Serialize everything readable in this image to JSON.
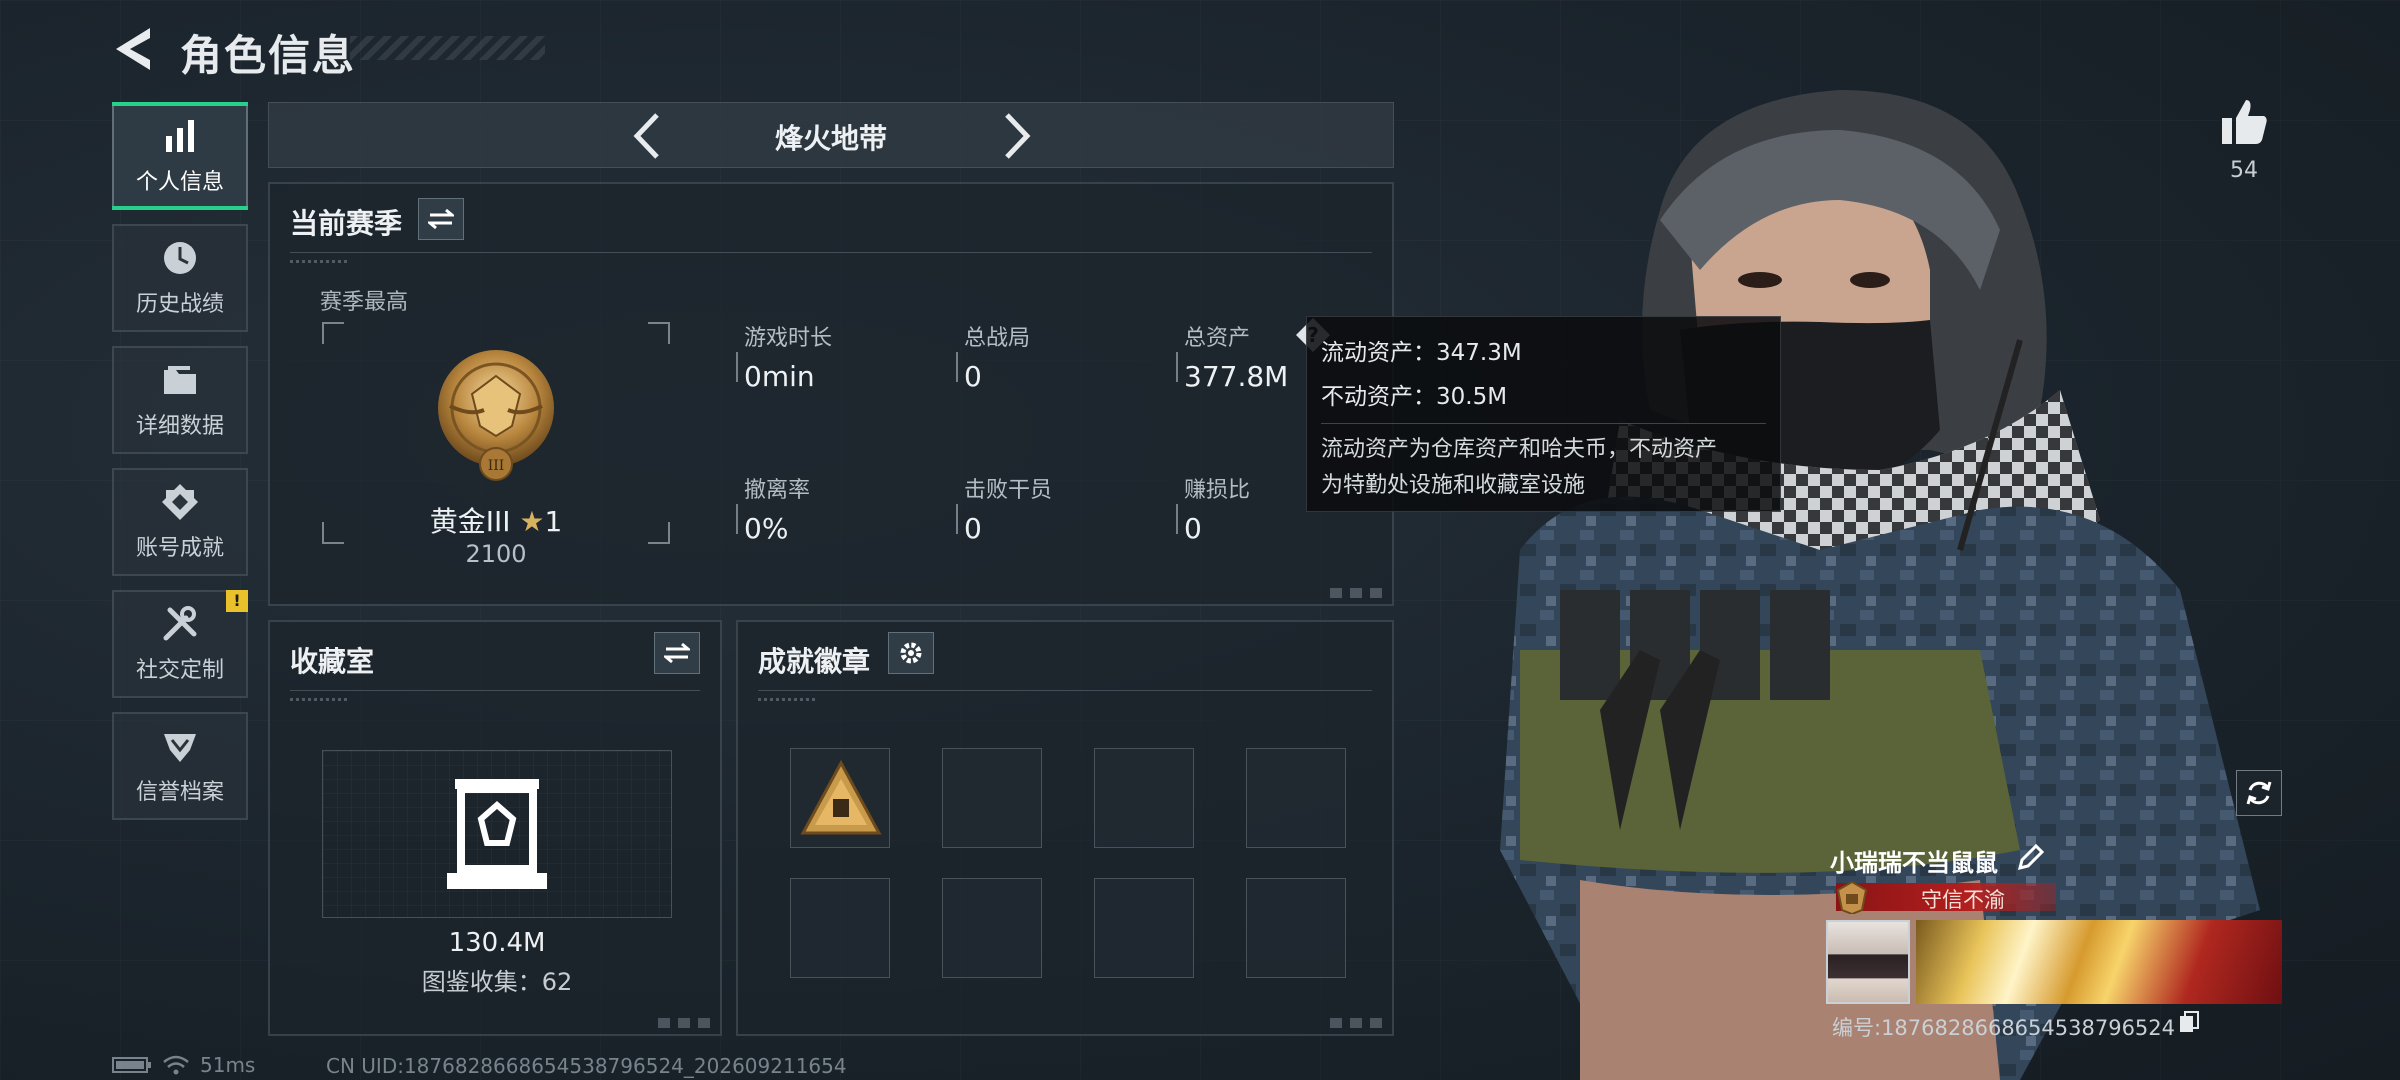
{
  "header": {
    "title": "角色信息"
  },
  "nav": {
    "items": [
      {
        "label": "个人信息",
        "icon": "bar-chart-icon",
        "active": true
      },
      {
        "label": "历史战绩",
        "icon": "history-clock-icon",
        "active": false
      },
      {
        "label": "详细数据",
        "icon": "folder-icon",
        "active": false
      },
      {
        "label": "账号成就",
        "icon": "achievement-emblem-icon",
        "active": false
      },
      {
        "label": "社交定制",
        "icon": "tools-icon",
        "active": false,
        "badge": "!"
      },
      {
        "label": "信誉档案",
        "icon": "credit-shield-icon",
        "active": false
      }
    ]
  },
  "mode": {
    "title": "烽火地带"
  },
  "season": {
    "title": "当前赛季",
    "best_label": "赛季最高",
    "rank_name": "黄金III",
    "rank_stars": "1",
    "rank_score": "2100",
    "stats": [
      {
        "label": "游戏时长",
        "value": "0min"
      },
      {
        "label": "总战局",
        "value": "0"
      },
      {
        "label": "总资产",
        "value": "377.8M"
      },
      {
        "label": "撤离率",
        "value": "0%"
      },
      {
        "label": "击败干员",
        "value": "0"
      },
      {
        "label": "赚损比",
        "value": "0"
      }
    ]
  },
  "tooltip": {
    "liquid": "流动资产：347.3M",
    "fixed": "不动资产：30.5M",
    "desc_1": "流动资产为仓库资产和哈夫币，不动资产",
    "desc_2": "为特勤处设施和收藏室设施"
  },
  "collection": {
    "title": "收藏室",
    "value": "130.4M",
    "count": "图鉴收集：62"
  },
  "badges": {
    "title": "成就徽章",
    "slots": 8
  },
  "likes": {
    "count": "54"
  },
  "player": {
    "name": "小瑞瑞不当鼠鼠",
    "title": "守信不渝",
    "id": "编号:1876828668654538796524"
  },
  "status": {
    "ping": "51ms",
    "uid": "CN UID:1876828668654538796524_202609211654"
  },
  "colors": {
    "accent_green": "#27d08b",
    "title_red": "#b21f1f",
    "badge_yellow": "#e9c22b"
  }
}
